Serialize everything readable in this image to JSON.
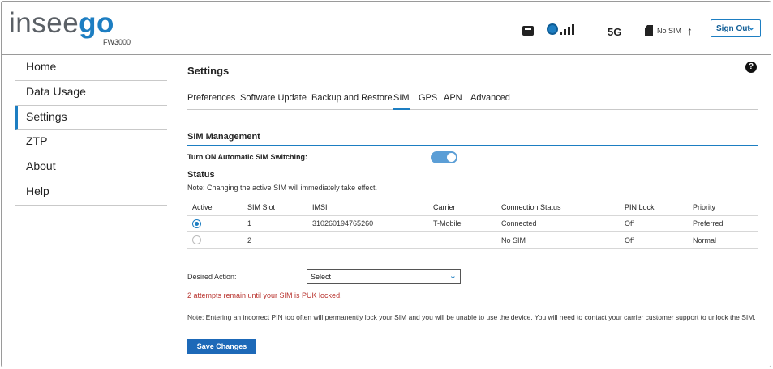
{
  "header": {
    "brand_part1": "insee",
    "brand_part2": "go",
    "model": "FW3000",
    "network": "5G",
    "sim_status": "No SIM",
    "upload_arrow": "↑",
    "sign_out": "Sign Out",
    "chevron": "⌄",
    "icons": [
      "router-icon",
      "globe-icon",
      "signal-bars-icon",
      "no-sim-icon",
      "upload-arrow-icon",
      "chevron-down-icon"
    ]
  },
  "sidebar": {
    "items": [
      {
        "label": "Home"
      },
      {
        "label": "Data Usage"
      },
      {
        "label": "Settings"
      },
      {
        "label": "ZTP"
      },
      {
        "label": "About"
      },
      {
        "label": "Help"
      }
    ]
  },
  "main": {
    "title": "Settings",
    "help": "?",
    "tabs": [
      {
        "label": "Preferences"
      },
      {
        "label": "Software Update"
      },
      {
        "label": "Backup and Restore"
      },
      {
        "label": "SIM"
      },
      {
        "label": "GPS"
      },
      {
        "label": "APN"
      },
      {
        "label": "Advanced"
      }
    ],
    "section_title": "SIM Management",
    "switch_label": "Turn ON Automatic SIM Switching:",
    "switch_on": true,
    "status_title": "Status",
    "status_note": "Note: Changing the active SIM will immediately take effect.",
    "table": {
      "headers": [
        "Active",
        "SIM Slot",
        "IMSI",
        "Carrier",
        "Connection Status",
        "PIN Lock",
        "Priority"
      ],
      "rows": [
        {
          "slot": "1",
          "imsi": "310260194765260",
          "carrier": "T-Mobile",
          "status": "Connected",
          "pin": "Off",
          "priority": "Preferred"
        },
        {
          "slot": "2",
          "imsi": "",
          "carrier": "",
          "status": "No SIM",
          "pin": "Off",
          "priority": "Normal"
        }
      ]
    },
    "desired_action_label": "Desired Action:",
    "select_value": "Select",
    "puk_warning": "2 attempts remain until your SIM is PUK locked.",
    "pin_note": "Note: Entering an incorrect PIN too often will permanently lock your SIM and you will be unable to use the device. You will need to contact your carrier customer support to unlock the SIM.",
    "save_button": "Save Changes"
  },
  "colors": {
    "accent": "#1d7ec2",
    "warning": "#b8322d",
    "button": "#1d69b8"
  }
}
